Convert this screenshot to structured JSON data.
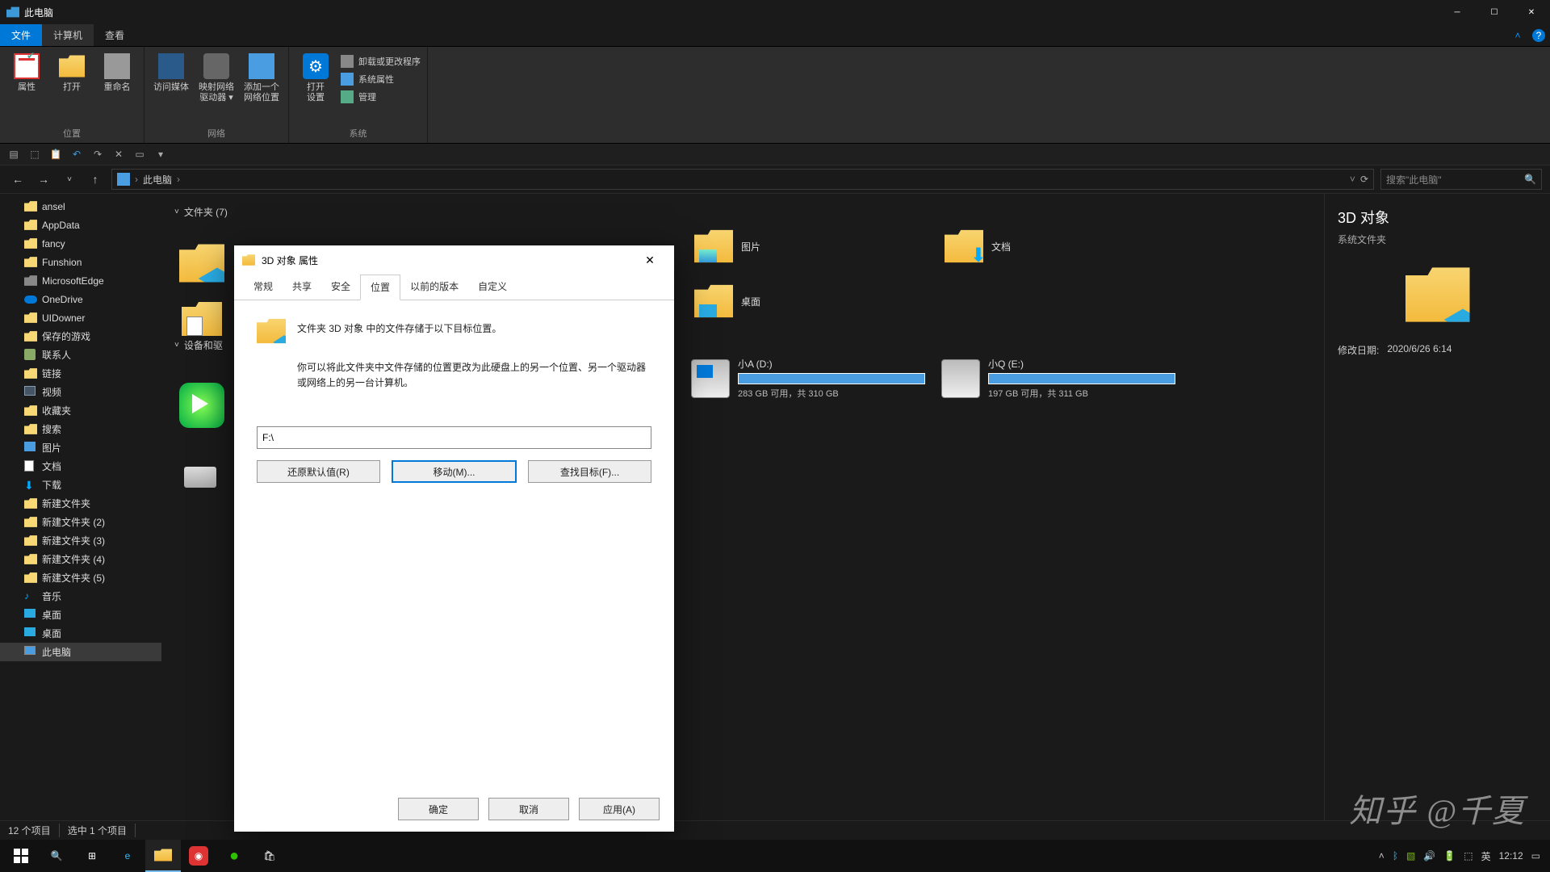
{
  "titlebar": {
    "title": "此电脑"
  },
  "menutabs": {
    "file": "文件",
    "computer": "计算机",
    "view": "查看"
  },
  "ribbon": {
    "g1": {
      "name": "位置",
      "btns": [
        "属性",
        "打开",
        "重命名"
      ]
    },
    "g2": {
      "name": "网络",
      "btns": [
        "访问媒体",
        "映射网络\n驱动器 ▾",
        "添加一个\n网络位置"
      ]
    },
    "g3": {
      "name": "系统",
      "open": "打开\n设置",
      "items": [
        "卸载或更改程序",
        "系统属性",
        "管理"
      ]
    }
  },
  "navbar": {
    "crumb": "此电脑",
    "search_ph": "搜索\"此电脑\""
  },
  "navtree": [
    {
      "label": "ansel",
      "ico": "folder-y"
    },
    {
      "label": "AppData",
      "ico": "folder-y"
    },
    {
      "label": "fancy",
      "ico": "folder-y"
    },
    {
      "label": "Funshion",
      "ico": "folder-y"
    },
    {
      "label": "MicrosoftEdge",
      "ico": "folder-g"
    },
    {
      "label": "OneDrive",
      "ico": "onedrive"
    },
    {
      "label": "UIDowner",
      "ico": "folder-y"
    },
    {
      "label": "保存的游戏",
      "ico": "folder-y"
    },
    {
      "label": "联系人",
      "ico": "contacts"
    },
    {
      "label": "链接",
      "ico": "folder-y"
    },
    {
      "label": "视频",
      "ico": "video"
    },
    {
      "label": "收藏夹",
      "ico": "folder-y"
    },
    {
      "label": "搜索",
      "ico": "folder-y"
    },
    {
      "label": "图片",
      "ico": "pictures"
    },
    {
      "label": "文档",
      "ico": "docs"
    },
    {
      "label": "下载",
      "ico": "download"
    },
    {
      "label": "新建文件夹",
      "ico": "folder-y"
    },
    {
      "label": "新建文件夹 (2)",
      "ico": "folder-y"
    },
    {
      "label": "新建文件夹 (3)",
      "ico": "folder-y"
    },
    {
      "label": "新建文件夹 (4)",
      "ico": "folder-y"
    },
    {
      "label": "新建文件夹 (5)",
      "ico": "folder-y"
    },
    {
      "label": "音乐",
      "ico": "music"
    },
    {
      "label": "桌面",
      "ico": "desktop"
    },
    {
      "label": "桌面",
      "ico": "desktop"
    },
    {
      "label": "此电脑",
      "ico": "pc",
      "sel": true
    }
  ],
  "content": {
    "folders_header": "文件夹 (7)",
    "devices_header": "设备和驱",
    "folders": [
      {
        "label": "图片"
      },
      {
        "label": "文档"
      },
      {
        "label": "桌面"
      }
    ],
    "drives": [
      {
        "name": "小A (D:)",
        "free": "283 GB 可用，共 310 GB"
      },
      {
        "name": "小Q  (E:)",
        "free": "197 GB 可用，共 311 GB"
      }
    ]
  },
  "details": {
    "title": "3D 对象",
    "sub": "系统文件夹",
    "date_k": "修改日期:",
    "date_v": "2020/6/26 6:14"
  },
  "status": {
    "a": "12 个项目",
    "b": "选中 1 个项目"
  },
  "dialog": {
    "title": "3D 对象 属性",
    "tabs": [
      "常规",
      "共享",
      "安全",
      "位置",
      "以前的版本",
      "自定义"
    ],
    "active_tab": "位置",
    "line1": "文件夹 3D 对象 中的文件存储于以下目标位置。",
    "line2": "你可以将此文件夹中文件存储的位置更改为此硬盘上的另一个位置、另一个驱动器或网络上的另一台计算机。",
    "path": "F:\\",
    "btn_restore": "还原默认值(R)",
    "btn_move": "移动(M)...",
    "btn_find": "查找目标(F)...",
    "ok": "确定",
    "cancel": "取消",
    "apply": "应用(A)"
  },
  "taskbar": {
    "ime": "英",
    "time": "12:12"
  },
  "watermark": "知乎 @千夏"
}
